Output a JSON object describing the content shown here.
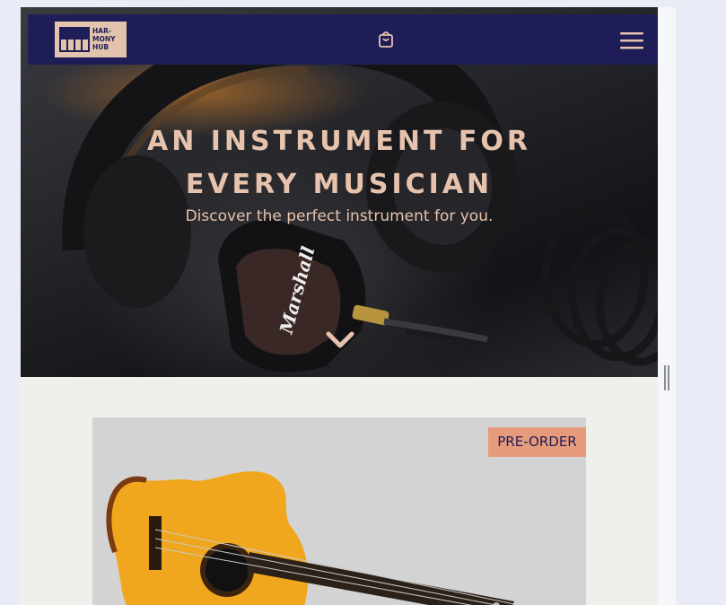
{
  "brand": {
    "logo_text": "HAR-\nMONY\nHUB"
  },
  "navbar": {
    "cart_icon": "shopping-bag-icon",
    "menu_icon": "hamburger-menu-icon"
  },
  "hero": {
    "title_line1": "AN INSTRUMENT FOR",
    "title_line2": "EVERY MUSICIAN",
    "subtitle": "Discover the perfect instrument for you.",
    "scroll_icon": "chevron-down-icon",
    "image_subject": "headphones",
    "headphone_brand": "Marshall"
  },
  "product": {
    "badge": "PRE-ORDER",
    "image_subject": "acoustic guitar"
  },
  "colors": {
    "navbar": "#1f1d57",
    "accent": "#e7c3ad",
    "badge": "#e69b7c",
    "content_bg": "#f0efec"
  }
}
